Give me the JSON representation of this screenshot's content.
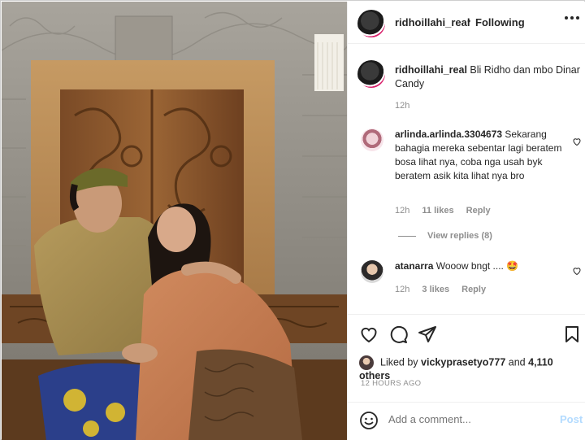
{
  "header": {
    "username": "ridhoillahi_real",
    "separator": "•",
    "follow_status": "Following",
    "more_label": "..."
  },
  "caption": {
    "username": "ridhoillahi_real",
    "text": "Bli Ridho dan mbo Dinar Candy",
    "time": "12h"
  },
  "comments": [
    {
      "username": "arlinda.arlinda.3304673",
      "text": "Sekarang bahagia mereka sebentar lagi beratem bosa lihat nya, coba nga usah byk beratem asik kita lihat nya bro",
      "time": "12h",
      "likes": "11 likes",
      "reply": "Reply",
      "view_replies": "View replies (8)"
    },
    {
      "username": "atanarra",
      "text": "Wooow bngt .... 🤩",
      "time": "12h",
      "likes": "3 likes",
      "reply": "Reply"
    }
  ],
  "likes": {
    "prefix": "Liked by",
    "user": "vickyprasetyo777",
    "joiner": "and",
    "others": "4,110 others"
  },
  "posted_ago": "12 HOURS AGO",
  "add_comment": {
    "placeholder": "Add a comment...",
    "post_label": "Post"
  },
  "colors": {
    "text": "#262626",
    "muted": "#8e8e8e",
    "post_disabled": "#b3dbff",
    "avatar_ring": "#d81f6a"
  },
  "icons": [
    "heart-icon",
    "comment-icon",
    "share-icon",
    "bookmark-icon",
    "emoji-icon",
    "more-icon"
  ]
}
